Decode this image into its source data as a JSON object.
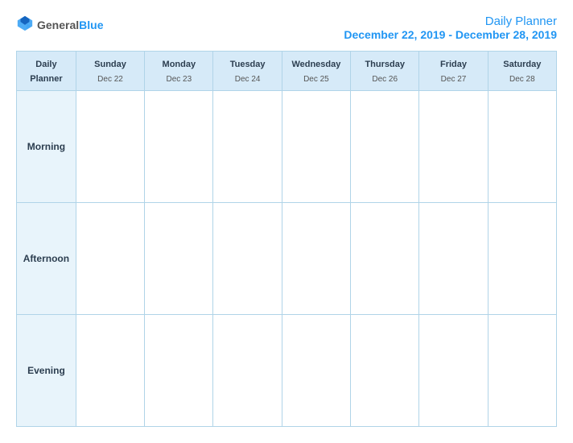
{
  "header": {
    "logo": {
      "general": "General",
      "blue": "Blue"
    },
    "title": "Daily Planner",
    "date_range": "December 22, 2019 - December 28, 2019"
  },
  "table": {
    "col_label": {
      "line1": "Daily",
      "line2": "Planner"
    },
    "columns": [
      {
        "day": "Sunday",
        "date": "Dec 22"
      },
      {
        "day": "Monday",
        "date": "Dec 23"
      },
      {
        "day": "Tuesday",
        "date": "Dec 24"
      },
      {
        "day": "Wednesday",
        "date": "Dec 25"
      },
      {
        "day": "Thursday",
        "date": "Dec 26"
      },
      {
        "day": "Friday",
        "date": "Dec 27"
      },
      {
        "day": "Saturday",
        "date": "Dec 28"
      }
    ],
    "rows": [
      {
        "label": "Morning"
      },
      {
        "label": "Afternoon"
      },
      {
        "label": "Evening"
      }
    ]
  }
}
